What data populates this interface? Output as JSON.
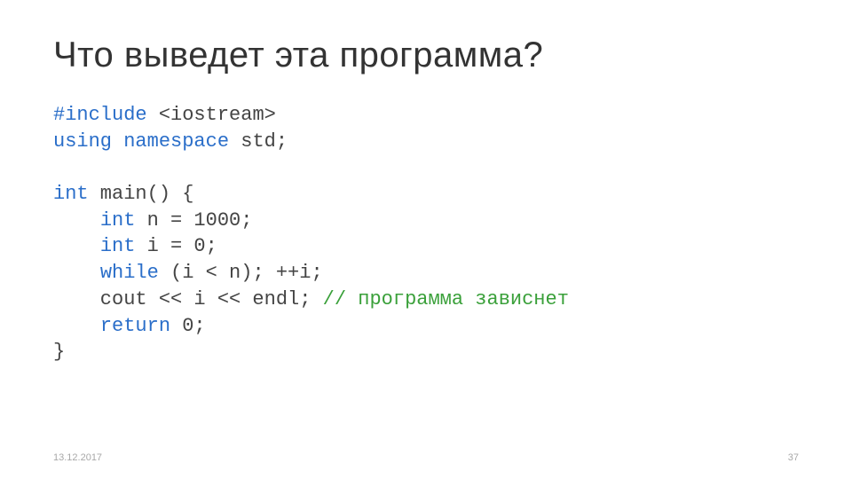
{
  "slide": {
    "title": "Что выведет эта программа?",
    "code": {
      "line1_a": "#include",
      "line1_b": " <iostream>",
      "line2_a": "using",
      "line2_b": " ",
      "line2_c": "namespace",
      "line2_d": " std;",
      "blank1": "",
      "line3_a": "int",
      "line3_b": " main() {",
      "line4_a": "    ",
      "line4_b": "int",
      "line4_c": " n = 1000;",
      "line5_a": "    ",
      "line5_b": "int",
      "line5_c": " i = 0;",
      "line6_a": "    ",
      "line6_b": "while",
      "line6_c": " (i < n); ++i;",
      "line7_a": "    cout << i << endl; ",
      "line7_comment": "// программа зависнет",
      "line8_a": "    ",
      "line8_b": "return",
      "line8_c": " 0;",
      "line9": "}"
    },
    "footer_date": "13.12.2017",
    "footer_page": "37"
  }
}
